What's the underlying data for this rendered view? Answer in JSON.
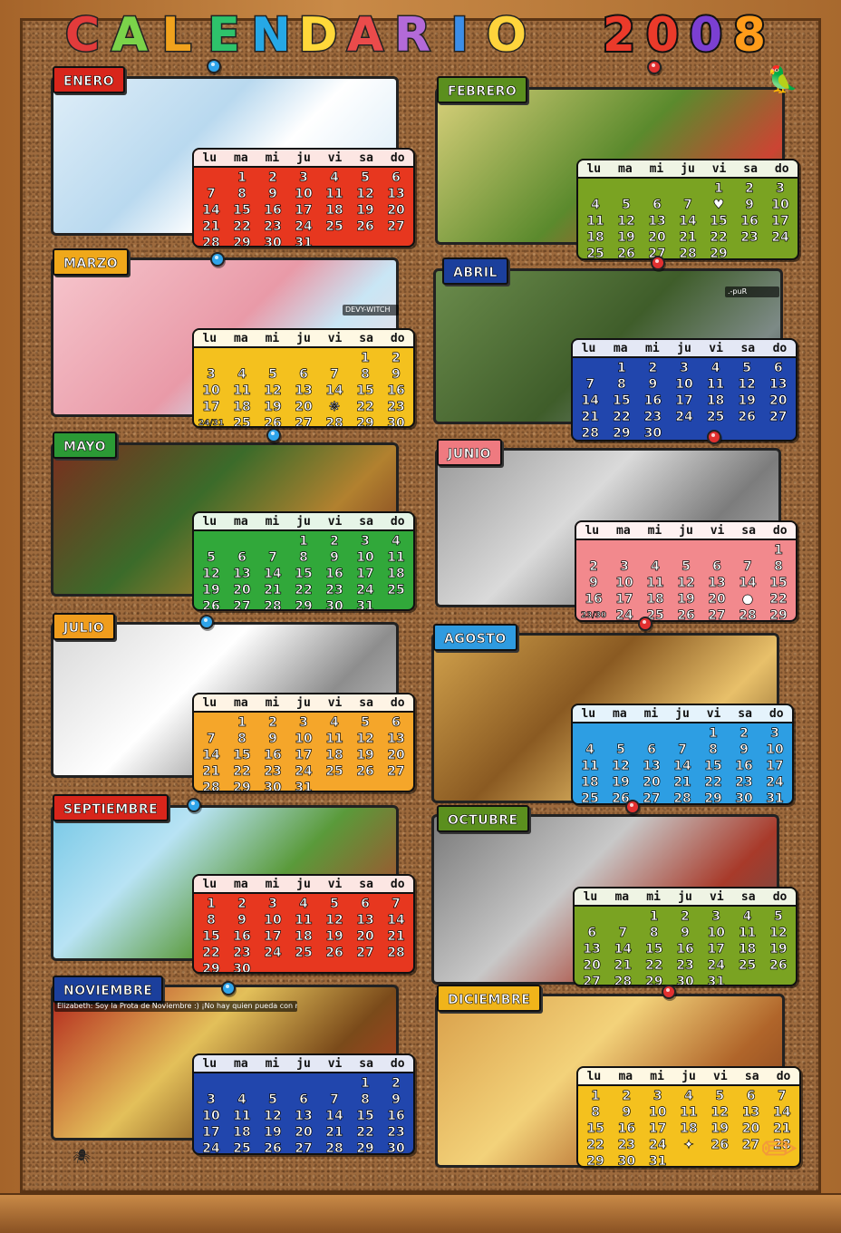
{
  "title": {
    "letters": [
      "C",
      "A",
      "L",
      "E",
      "N",
      "D",
      "A",
      "R",
      "I",
      "O"
    ],
    "letter_colors": [
      "#e23b3b",
      "#7bd34a",
      "#f1a21d",
      "#2ec36b",
      "#26a8e6",
      "#ffd83a",
      "#ea4b4b",
      "#b36ad8",
      "#3c8ee8",
      "#ffd43c"
    ],
    "year": [
      "2",
      "0",
      "0",
      "8"
    ],
    "year_colors": [
      "#ea3a2a",
      "#ea3a2a",
      "#7b3fd1",
      "#ff9c1a"
    ]
  },
  "weekdays": [
    "lu",
    "ma",
    "mi",
    "ju",
    "vi",
    "sa",
    "do"
  ],
  "months": [
    {
      "name": "ENERO",
      "label_color": "#d8251b",
      "cal_color": "#e7371f",
      "pin_color": "#2fa4ea",
      "days": [
        "",
        "1",
        "2",
        "3",
        "4",
        "5",
        "6",
        "7",
        "8",
        "9",
        "10",
        "11",
        "12",
        "13",
        "14",
        "15",
        "16",
        "17",
        "18",
        "19",
        "20",
        "21",
        "22",
        "23",
        "24",
        "25",
        "26",
        "27",
        "28",
        "29",
        "30",
        "31"
      ]
    },
    {
      "name": "FEBRERO",
      "label_color": "#5b8f1e",
      "cal_color": "#7aa322",
      "pin_color": "#e23030",
      "days": [
        "",
        "",
        "",
        "",
        "1",
        "2",
        "3",
        "4",
        "5",
        "6",
        "7",
        "♥",
        "9",
        "10",
        "11",
        "12",
        "13",
        "14",
        "15",
        "16",
        "17",
        "18",
        "19",
        "20",
        "21",
        "22",
        "23",
        "24",
        "25",
        "26",
        "27",
        "28",
        "29"
      ]
    },
    {
      "name": "MARZO",
      "label_color": "#f0a81a",
      "cal_color": "#f4c11e",
      "pin_color": "#2fa4ea",
      "days": [
        "",
        "",
        "",
        "",
        "",
        "1",
        "2",
        "3",
        "4",
        "5",
        "6",
        "7",
        "8",
        "9",
        "10",
        "11",
        "12",
        "13",
        "14",
        "15",
        "16",
        "17",
        "18",
        "19",
        "20",
        "❋",
        "22",
        "23",
        "24/31",
        "25",
        "26",
        "27",
        "28",
        "29",
        "30"
      ]
    },
    {
      "name": "ABRIL",
      "label_color": "#1b3f9c",
      "cal_color": "#2146ad",
      "pin_color": "#e23030",
      "days": [
        "",
        "1",
        "2",
        "3",
        "4",
        "5",
        "6",
        "7",
        "8",
        "9",
        "10",
        "11",
        "12",
        "13",
        "14",
        "15",
        "16",
        "17",
        "18",
        "19",
        "20",
        "21",
        "22",
        "23",
        "24",
        "25",
        "26",
        "27",
        "28",
        "29",
        "30"
      ]
    },
    {
      "name": "MAYO",
      "label_color": "#2b9a35",
      "cal_color": "#31a83a",
      "pin_color": "#2fa4ea",
      "days": [
        "",
        "",
        "",
        "1",
        "2",
        "3",
        "4",
        "5",
        "6",
        "7",
        "8",
        "9",
        "10",
        "11",
        "12",
        "13",
        "14",
        "15",
        "16",
        "17",
        "18",
        "19",
        "20",
        "21",
        "22",
        "23",
        "24",
        "25",
        "26",
        "27",
        "28",
        "29",
        "30",
        "31"
      ]
    },
    {
      "name": "JUNIO",
      "label_color": "#ef7a80",
      "cal_color": "#f2898d",
      "pin_color": "#e23030",
      "days": [
        "",
        "",
        "",
        "",
        "",
        "",
        "1",
        "2",
        "3",
        "4",
        "5",
        "6",
        "7",
        "8",
        "9",
        "10",
        "11",
        "12",
        "13",
        "14",
        "15",
        "16",
        "17",
        "18",
        "19",
        "20",
        "●",
        "22",
        "23/30",
        "24",
        "25",
        "26",
        "27",
        "28",
        "29"
      ]
    },
    {
      "name": "JULIO",
      "label_color": "#f09d1d",
      "cal_color": "#f5a62a",
      "pin_color": "#2fa4ea",
      "days": [
        "",
        "1",
        "2",
        "3",
        "4",
        "5",
        "6",
        "7",
        "8",
        "9",
        "10",
        "11",
        "12",
        "13",
        "14",
        "15",
        "16",
        "17",
        "18",
        "19",
        "20",
        "21",
        "22",
        "23",
        "24",
        "25",
        "26",
        "27",
        "28",
        "29",
        "30",
        "31"
      ]
    },
    {
      "name": "AGOSTO",
      "label_color": "#2f9be0",
      "cal_color": "#2d9ee3",
      "pin_color": "#e23030",
      "days": [
        "",
        "",
        "",
        "",
        "1",
        "2",
        "3",
        "4",
        "5",
        "6",
        "7",
        "8",
        "9",
        "10",
        "11",
        "12",
        "13",
        "14",
        "15",
        "16",
        "17",
        "18",
        "19",
        "20",
        "21",
        "22",
        "23",
        "24",
        "25",
        "26",
        "27",
        "28",
        "29",
        "30",
        "31"
      ]
    },
    {
      "name": "SEPTIEMBRE",
      "label_color": "#d8251b",
      "cal_color": "#e7371f",
      "pin_color": "#2fa4ea",
      "days": [
        "1",
        "2",
        "3",
        "4",
        "5",
        "6",
        "7",
        "8",
        "9",
        "10",
        "11",
        "12",
        "13",
        "14",
        "15",
        "16",
        "17",
        "18",
        "19",
        "20",
        "21",
        "22",
        "23",
        "24",
        "25",
        "26",
        "27",
        "28",
        "29",
        "30"
      ]
    },
    {
      "name": "OCTUBRE",
      "label_color": "#5b8f1e",
      "cal_color": "#7aa322",
      "pin_color": "#e23030",
      "days": [
        "",
        "",
        "1",
        "2",
        "3",
        "4",
        "5",
        "6",
        "7",
        "8",
        "9",
        "10",
        "11",
        "12",
        "13",
        "14",
        "15",
        "16",
        "17",
        "18",
        "19",
        "20",
        "21",
        "22",
        "23",
        "24",
        "25",
        "26",
        "27",
        "28",
        "29",
        "30",
        "31"
      ]
    },
    {
      "name": "NOVIEMBRE",
      "label_color": "#1b3f9c",
      "cal_color": "#2146ad",
      "pin_color": "#2fa4ea",
      "days": [
        "",
        "",
        "",
        "",
        "",
        "1",
        "2",
        "3",
        "4",
        "5",
        "6",
        "7",
        "8",
        "9",
        "10",
        "11",
        "12",
        "13",
        "14",
        "15",
        "16",
        "17",
        "18",
        "19",
        "20",
        "21",
        "22",
        "23",
        "24",
        "25",
        "26",
        "27",
        "28",
        "29",
        "30"
      ]
    },
    {
      "name": "DICIEMBRE",
      "label_color": "#f0b41a",
      "cal_color": "#f4c11e",
      "pin_color": "#e23030",
      "days": [
        "1",
        "2",
        "3",
        "4",
        "5",
        "6",
        "7",
        "8",
        "9",
        "10",
        "11",
        "12",
        "13",
        "14",
        "15",
        "16",
        "17",
        "18",
        "19",
        "20",
        "21",
        "22",
        "23",
        "24",
        "✦",
        "26",
        "27",
        "28",
        "29",
        "30",
        "31"
      ]
    }
  ],
  "photo_captions": {
    "marzo_tag": "DEVY-WITCH",
    "abril_tag": ".-puR",
    "noviembre_chat": "Elizabeth: Soy la Prota de Noviembre :) ¡No hay quien pueda con mi look! :)"
  }
}
